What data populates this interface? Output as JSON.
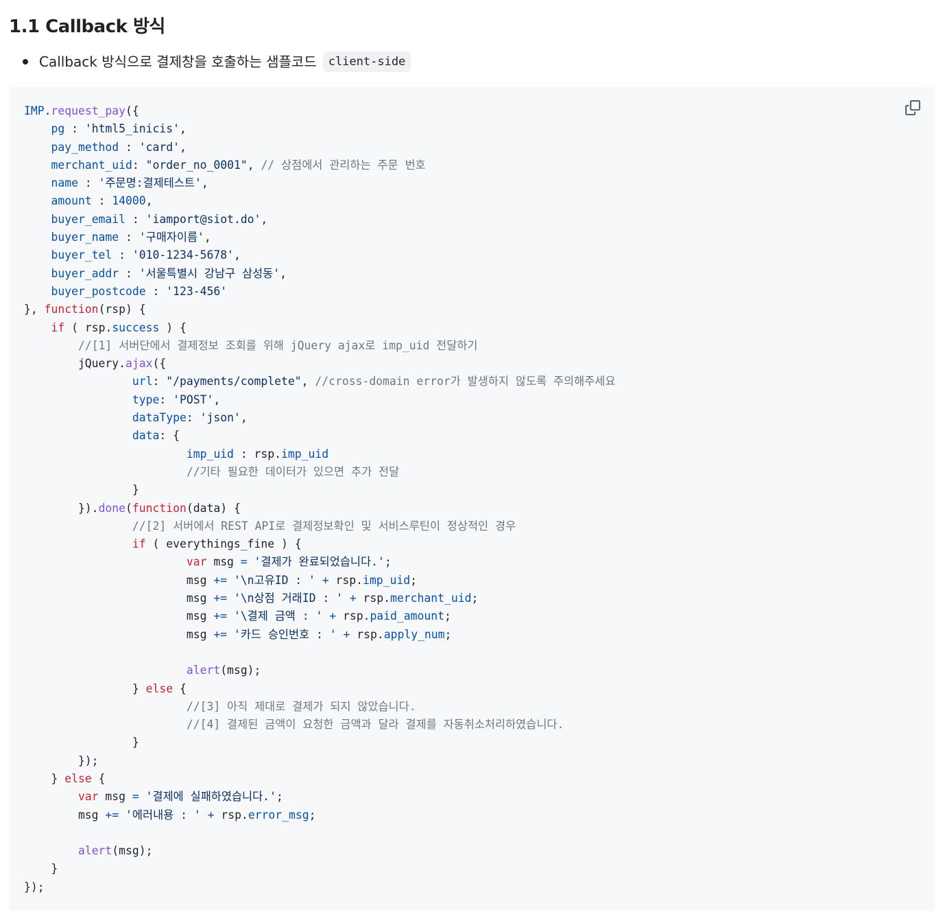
{
  "heading": "1.1 Callback 방식",
  "bullet": {
    "text": "Callback 방식으로 결제창을 호출하는 샘플코드",
    "code_tag": "client-side"
  },
  "code": {
    "copy_icon": "copy-icon",
    "lines": [
      [
        [
          "prop",
          "IMP"
        ],
        [
          "plain",
          "."
        ],
        [
          "fn",
          "request_pay"
        ],
        [
          "plain",
          "({"
        ]
      ],
      [
        [
          "plain",
          "    "
        ],
        [
          "prop",
          "pg"
        ],
        [
          "plain",
          " : "
        ],
        [
          "str",
          "'html5_inicis'"
        ],
        [
          "plain",
          ","
        ]
      ],
      [
        [
          "plain",
          "    "
        ],
        [
          "prop",
          "pay_method"
        ],
        [
          "plain",
          " : "
        ],
        [
          "str",
          "'card'"
        ],
        [
          "plain",
          ","
        ]
      ],
      [
        [
          "plain",
          "    "
        ],
        [
          "prop",
          "merchant_uid"
        ],
        [
          "plain",
          ": "
        ],
        [
          "str",
          "\"order_no_0001\""
        ],
        [
          "plain",
          ", "
        ],
        [
          "com",
          "// 상점에서 관리하는 주문 번호"
        ]
      ],
      [
        [
          "plain",
          "    "
        ],
        [
          "prop",
          "name"
        ],
        [
          "plain",
          " : "
        ],
        [
          "str",
          "'주문명:결제테스트'"
        ],
        [
          "plain",
          ","
        ]
      ],
      [
        [
          "plain",
          "    "
        ],
        [
          "prop",
          "amount"
        ],
        [
          "plain",
          " : "
        ],
        [
          "num",
          "14000"
        ],
        [
          "plain",
          ","
        ]
      ],
      [
        [
          "plain",
          "    "
        ],
        [
          "prop",
          "buyer_email"
        ],
        [
          "plain",
          " : "
        ],
        [
          "str",
          "'iamport@siot.do'"
        ],
        [
          "plain",
          ","
        ]
      ],
      [
        [
          "plain",
          "    "
        ],
        [
          "prop",
          "buyer_name"
        ],
        [
          "plain",
          " : "
        ],
        [
          "str",
          "'구매자이름'"
        ],
        [
          "plain",
          ","
        ]
      ],
      [
        [
          "plain",
          "    "
        ],
        [
          "prop",
          "buyer_tel"
        ],
        [
          "plain",
          " : "
        ],
        [
          "str",
          "'010-1234-5678'"
        ],
        [
          "plain",
          ","
        ]
      ],
      [
        [
          "plain",
          "    "
        ],
        [
          "prop",
          "buyer_addr"
        ],
        [
          "plain",
          " : "
        ],
        [
          "str",
          "'서울특별시 강남구 삼성동'"
        ],
        [
          "plain",
          ","
        ]
      ],
      [
        [
          "plain",
          "    "
        ],
        [
          "prop",
          "buyer_postcode"
        ],
        [
          "plain",
          " : "
        ],
        [
          "str",
          "'123-456'"
        ]
      ],
      [
        [
          "plain",
          "}, "
        ],
        [
          "kw",
          "function"
        ],
        [
          "plain",
          "(rsp) {"
        ]
      ],
      [
        [
          "plain",
          "    "
        ],
        [
          "kw",
          "if"
        ],
        [
          "plain",
          " ( rsp."
        ],
        [
          "prop",
          "success"
        ],
        [
          "plain",
          " ) {"
        ]
      ],
      [
        [
          "plain",
          "        "
        ],
        [
          "com",
          "//[1] 서버단에서 결제정보 조회를 위해 jQuery ajax로 imp_uid 전달하기"
        ]
      ],
      [
        [
          "plain",
          "        jQuery."
        ],
        [
          "fn",
          "ajax"
        ],
        [
          "plain",
          "({"
        ]
      ],
      [
        [
          "plain",
          "                "
        ],
        [
          "prop",
          "url"
        ],
        [
          "plain",
          ": "
        ],
        [
          "str",
          "\"/payments/complete\""
        ],
        [
          "plain",
          ", "
        ],
        [
          "com",
          "//cross-domain error가 발생하지 않도록 주의해주세요"
        ]
      ],
      [
        [
          "plain",
          "                "
        ],
        [
          "prop",
          "type"
        ],
        [
          "plain",
          ": "
        ],
        [
          "str",
          "'POST'"
        ],
        [
          "plain",
          ","
        ]
      ],
      [
        [
          "plain",
          "                "
        ],
        [
          "prop",
          "dataType"
        ],
        [
          "plain",
          ": "
        ],
        [
          "str",
          "'json'"
        ],
        [
          "plain",
          ","
        ]
      ],
      [
        [
          "plain",
          "                "
        ],
        [
          "prop",
          "data"
        ],
        [
          "plain",
          ": {"
        ]
      ],
      [
        [
          "plain",
          "                        "
        ],
        [
          "prop",
          "imp_uid"
        ],
        [
          "plain",
          " : rsp."
        ],
        [
          "prop",
          "imp_uid"
        ]
      ],
      [
        [
          "plain",
          "                        "
        ],
        [
          "com",
          "//기타 필요한 데이터가 있으면 추가 전달"
        ]
      ],
      [
        [
          "plain",
          "                }"
        ]
      ],
      [
        [
          "plain",
          "        })."
        ],
        [
          "fn",
          "done"
        ],
        [
          "plain",
          "("
        ],
        [
          "kw",
          "function"
        ],
        [
          "plain",
          "(data) {"
        ]
      ],
      [
        [
          "plain",
          "                "
        ],
        [
          "com",
          "//[2] 서버에서 REST API로 결제정보확인 및 서비스루틴이 정상적인 경우"
        ]
      ],
      [
        [
          "plain",
          "                "
        ],
        [
          "kw",
          "if"
        ],
        [
          "plain",
          " ( everythings_fine ) {"
        ]
      ],
      [
        [
          "plain",
          "                        "
        ],
        [
          "kw",
          "var"
        ],
        [
          "plain",
          " msg "
        ],
        [
          "prop",
          "="
        ],
        [
          "plain",
          " "
        ],
        [
          "str",
          "'결제가 완료되었습니다.'"
        ],
        [
          "plain",
          ";"
        ]
      ],
      [
        [
          "plain",
          "                        msg "
        ],
        [
          "prop",
          "+="
        ],
        [
          "plain",
          " "
        ],
        [
          "str",
          "'\\n고유ID : '"
        ],
        [
          "plain",
          " "
        ],
        [
          "prop",
          "+"
        ],
        [
          "plain",
          " rsp."
        ],
        [
          "prop",
          "imp_uid"
        ],
        [
          "plain",
          ";"
        ]
      ],
      [
        [
          "plain",
          "                        msg "
        ],
        [
          "prop",
          "+="
        ],
        [
          "plain",
          " "
        ],
        [
          "str",
          "'\\n상점 거래ID : '"
        ],
        [
          "plain",
          " "
        ],
        [
          "prop",
          "+"
        ],
        [
          "plain",
          " rsp."
        ],
        [
          "prop",
          "merchant_uid"
        ],
        [
          "plain",
          ";"
        ]
      ],
      [
        [
          "plain",
          "                        msg "
        ],
        [
          "prop",
          "+="
        ],
        [
          "plain",
          " "
        ],
        [
          "str",
          "'\\결제 금액 : '"
        ],
        [
          "plain",
          " "
        ],
        [
          "prop",
          "+"
        ],
        [
          "plain",
          " rsp."
        ],
        [
          "prop",
          "paid_amount"
        ],
        [
          "plain",
          ";"
        ]
      ],
      [
        [
          "plain",
          "                        msg "
        ],
        [
          "prop",
          "+="
        ],
        [
          "plain",
          " "
        ],
        [
          "str",
          "'카드 승인번호 : '"
        ],
        [
          "plain",
          " "
        ],
        [
          "prop",
          "+"
        ],
        [
          "plain",
          " rsp."
        ],
        [
          "prop",
          "apply_num"
        ],
        [
          "plain",
          ";"
        ]
      ],
      [
        [
          "plain",
          ""
        ]
      ],
      [
        [
          "plain",
          "                        "
        ],
        [
          "fn",
          "alert"
        ],
        [
          "plain",
          "(msg);"
        ]
      ],
      [
        [
          "plain",
          "                } "
        ],
        [
          "kw",
          "else"
        ],
        [
          "plain",
          " {"
        ]
      ],
      [
        [
          "plain",
          "                        "
        ],
        [
          "com",
          "//[3] 아직 제대로 결제가 되지 않았습니다."
        ]
      ],
      [
        [
          "plain",
          "                        "
        ],
        [
          "com",
          "//[4] 결제된 금액이 요청한 금액과 달라 결제를 자동취소처리하였습니다."
        ]
      ],
      [
        [
          "plain",
          "                }"
        ]
      ],
      [
        [
          "plain",
          "        });"
        ]
      ],
      [
        [
          "plain",
          "    } "
        ],
        [
          "kw",
          "else"
        ],
        [
          "plain",
          " {"
        ]
      ],
      [
        [
          "plain",
          "        "
        ],
        [
          "kw",
          "var"
        ],
        [
          "plain",
          " msg "
        ],
        [
          "prop",
          "="
        ],
        [
          "plain",
          " "
        ],
        [
          "str",
          "'결제에 실패하였습니다.'"
        ],
        [
          "plain",
          ";"
        ]
      ],
      [
        [
          "plain",
          "        msg "
        ],
        [
          "prop",
          "+="
        ],
        [
          "plain",
          " "
        ],
        [
          "str",
          "'에러내용 : '"
        ],
        [
          "plain",
          " "
        ],
        [
          "prop",
          "+"
        ],
        [
          "plain",
          " rsp."
        ],
        [
          "prop",
          "error_msg"
        ],
        [
          "plain",
          ";"
        ]
      ],
      [
        [
          "plain",
          ""
        ]
      ],
      [
        [
          "plain",
          "        "
        ],
        [
          "fn",
          "alert"
        ],
        [
          "plain",
          "(msg);"
        ]
      ],
      [
        [
          "plain",
          "    }"
        ]
      ],
      [
        [
          "plain",
          "});"
        ]
      ]
    ]
  }
}
